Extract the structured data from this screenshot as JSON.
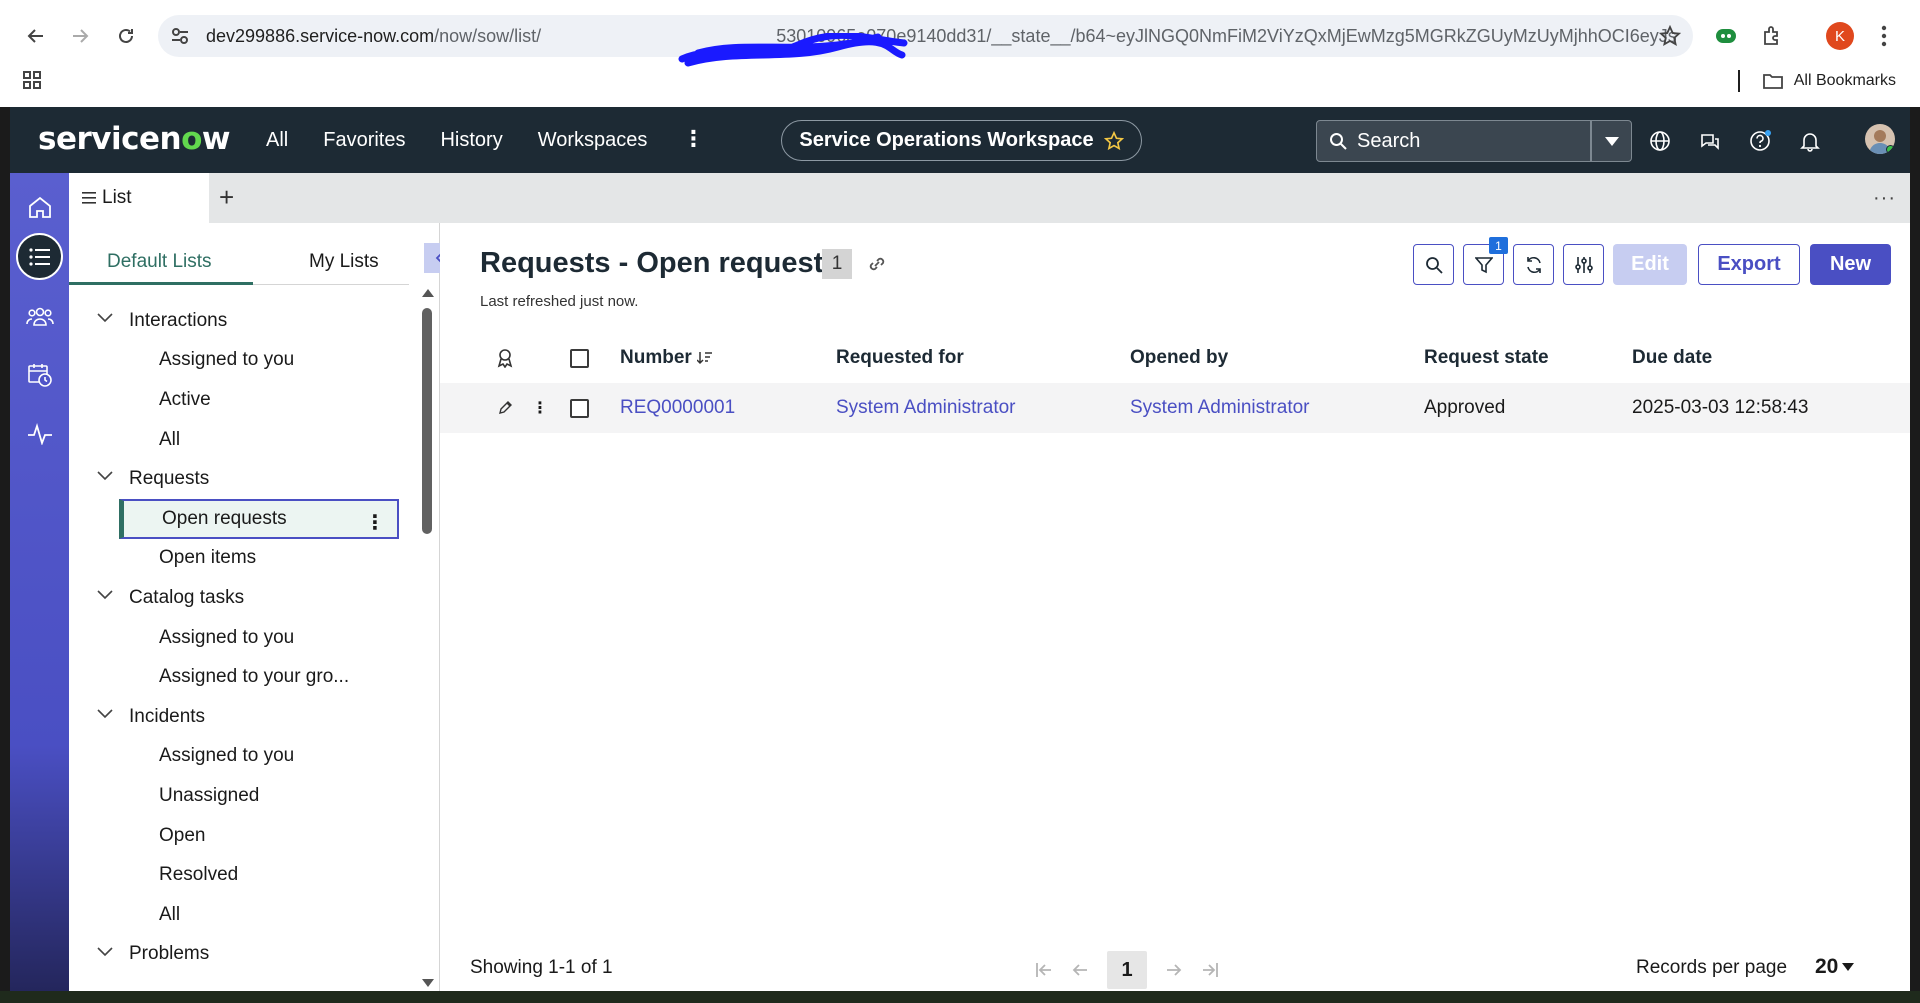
{
  "browser": {
    "url_host": "dev299886.service-now.com",
    "url_path": "/now/sow/list/",
    "url_tail": "53010965e070e9140dd31/__state__/b64~eyJlNGQ0NmFiM2ViYzQxMjEwMzg5MGRkZGUyMzUyMjhhOCI6eyJsaX...",
    "bookmarks_label": "All Bookmarks",
    "profile_initial": "K"
  },
  "header": {
    "logo_prefix": "servicen",
    "logo_o": "o",
    "logo_suffix": "w",
    "menu": [
      "All",
      "Favorites",
      "History",
      "Workspaces"
    ],
    "workspace_title": "Service Operations Workspace",
    "search_placeholder": "Search"
  },
  "tabs": {
    "list_tab_label": "List"
  },
  "listnav": {
    "tab_default": "Default Lists",
    "tab_mine": "My Lists",
    "groups": [
      {
        "label": "Interactions",
        "items": [
          "Assigned to you",
          "Active",
          "All"
        ]
      },
      {
        "label": "Requests",
        "items": [
          "Open requests",
          "Open items"
        ]
      },
      {
        "label": "Catalog tasks",
        "items": [
          "Assigned to you",
          "Assigned to your gro..."
        ]
      },
      {
        "label": "Incidents",
        "items": [
          "Assigned to you",
          "Unassigned",
          "Open",
          "Resolved",
          "All"
        ]
      },
      {
        "label": "Problems",
        "items": []
      }
    ],
    "selected": "Open requests"
  },
  "main": {
    "title": "Requests - Open requests",
    "count": "1",
    "refreshed": "Last refreshed just now.",
    "filter_count": "1",
    "edit_label": "Edit",
    "export_label": "Export",
    "new_label": "New",
    "columns": [
      "Number",
      "Requested for",
      "Opened by",
      "Request state",
      "Due date"
    ],
    "rows": [
      {
        "number": "REQ0000001",
        "requested_for": "System Administrator",
        "opened_by": "System Administrator",
        "state": "Approved",
        "due": "2025-03-03 12:58:43"
      }
    ],
    "showing": "Showing 1-1 of 1",
    "page": "1",
    "records_per_page_label": "Records per page",
    "records_per_page": "20"
  },
  "colors": {
    "accent": "#4a4fc3",
    "header_bg": "#1d2a34",
    "selected_green": "#2f6f63"
  }
}
